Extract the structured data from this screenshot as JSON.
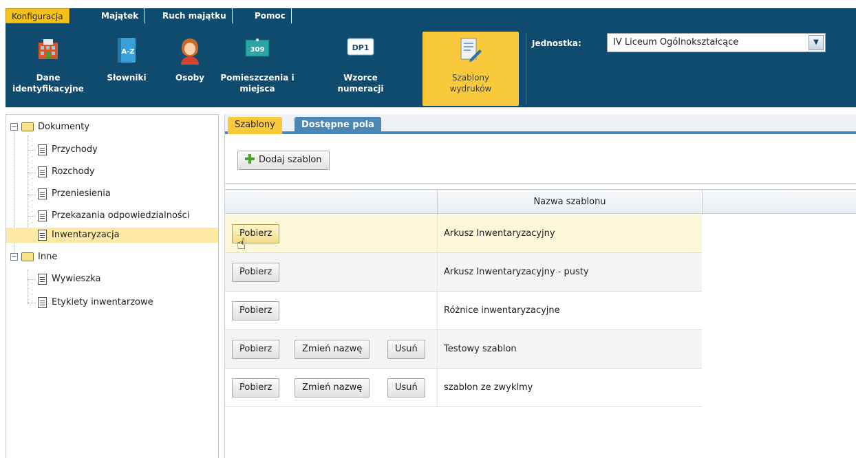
{
  "menu": {
    "tabs": [
      {
        "label": "Konfiguracja",
        "active": true
      },
      {
        "label": "Majątek",
        "active": false
      },
      {
        "label": "Ruch majątku",
        "active": false
      },
      {
        "label": "Pomoc",
        "active": false
      }
    ]
  },
  "ribbon": {
    "buttons": [
      {
        "label": "Dane\nidentyfikacyjne",
        "icon": "building-icon"
      },
      {
        "label": "Słowniki",
        "icon": "dictionary-icon",
        "icon_text": "A-Z"
      },
      {
        "label": "Osoby",
        "icon": "person-icon"
      },
      {
        "label": "Pomieszczenia i\nmiejsca",
        "icon": "room-number-icon",
        "icon_text": "309"
      },
      {
        "label": "Wzorce\nnumeracji",
        "icon": "numbering-icon",
        "icon_text": "DP1"
      },
      {
        "label": "Szablony\nwydruków",
        "icon": "template-icon",
        "active": true
      }
    ],
    "unit_label": "Jednostka:",
    "unit_value": "IV Liceum Ogólnokształcące"
  },
  "tree": {
    "groups": [
      {
        "label": "Dokumenty",
        "items": [
          "Przychody",
          "Rozchody",
          "Przeniesienia",
          "Przekazania odpowiedzialności",
          "Inwentaryzacja"
        ]
      },
      {
        "label": "Inne",
        "items": [
          "Wywieszka",
          "Etykiety inwentarzowe"
        ]
      }
    ],
    "selected": "Inwentaryzacja"
  },
  "panel": {
    "tabs": [
      "Szablony",
      "Dostępne pola"
    ],
    "add_button": "Dodaj szablon",
    "column_header": "Nazwa szablonu",
    "rows": [
      {
        "name": "Arkusz Inwentaryzacyjny",
        "buttons": [
          "Pobierz"
        ]
      },
      {
        "name": "Arkusz Inwentaryzacyjny - pusty",
        "buttons": [
          "Pobierz"
        ]
      },
      {
        "name": "Różnice inwentaryzacyjne",
        "buttons": [
          "Pobierz"
        ]
      },
      {
        "name": "Testowy szablon",
        "buttons": [
          "Pobierz",
          "Zmień nazwę",
          "Usuń"
        ]
      },
      {
        "name": "szablon ze zwyklmy",
        "buttons": [
          "Pobierz",
          "Zmień nazwę",
          "Usuń"
        ]
      }
    ]
  },
  "colors": {
    "accent": "#f7c93b",
    "ribbon": "#0f4a6f",
    "tab_blue": "#4b86b5"
  }
}
